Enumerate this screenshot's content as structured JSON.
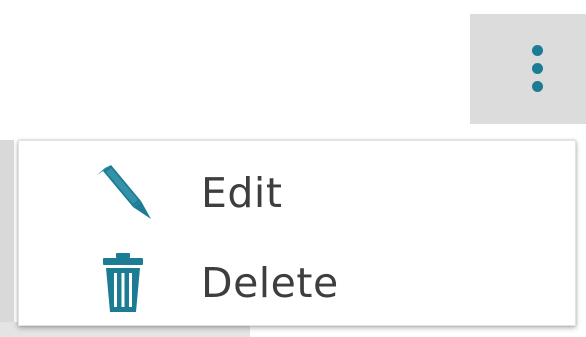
{
  "menu": {
    "items": [
      {
        "label": "Edit",
        "icon": "pencil-icon"
      },
      {
        "label": "Delete",
        "icon": "trash-icon"
      }
    ]
  },
  "kebab": {
    "icon": "more-vertical-icon"
  },
  "colors": {
    "accent": "#1c7c93",
    "text": "#3e3e3e",
    "button_bg": "#dcdcdc"
  }
}
